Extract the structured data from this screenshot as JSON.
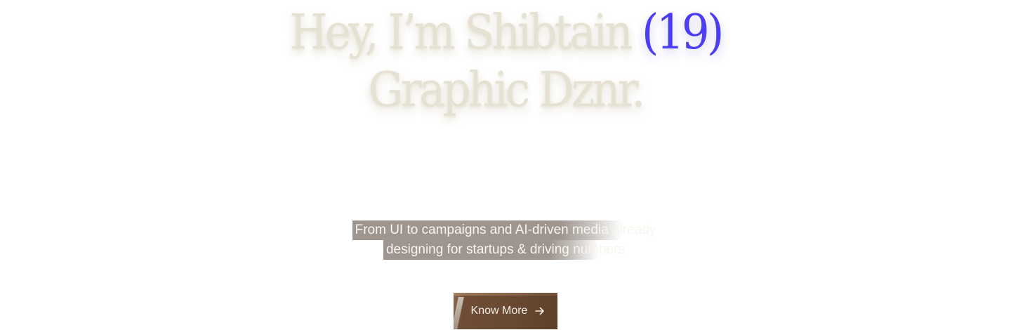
{
  "hero": {
    "heading_line1": "Hey, I’m Shibtain",
    "heading_age": "(19)",
    "heading_line2": "Graphic Dznr."
  },
  "subtitle": {
    "line1": "From UI to campaigns and AI-driven media already",
    "line2": "designing for startups & driving numbers"
  },
  "cta": {
    "label": "Know More",
    "icon": "arrow-right-icon"
  },
  "colors": {
    "heading": "#e5e2d3",
    "accent": "#4b3df0",
    "subtitle_bg": "#9e958f",
    "button_bg": "#6a4a33",
    "button_text": "#f4efe7"
  }
}
